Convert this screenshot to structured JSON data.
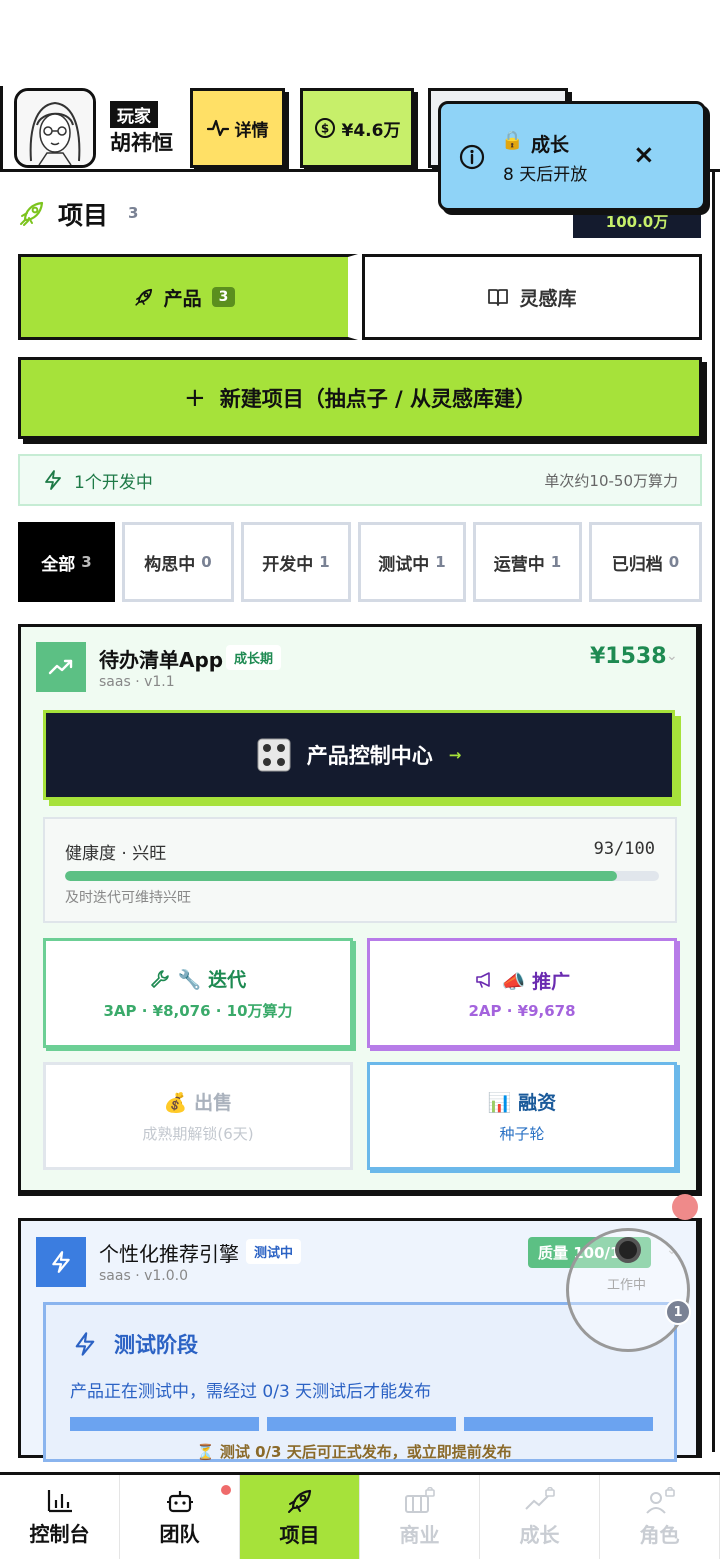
{
  "header": {
    "player_tag": "玩家",
    "player_name": "胡祎恒",
    "detail_label": "详情",
    "money_label": "¥4.6万"
  },
  "toast": {
    "title": "成长",
    "subtitle": "8 天后开放",
    "close": "×"
  },
  "dark_badge": "100.0万",
  "section": {
    "title": "项目",
    "count": "3"
  },
  "tabs": [
    {
      "label": "产品",
      "badge": "3"
    },
    {
      "label": "灵感库"
    }
  ],
  "new_project_label": "新建项目（抽点子 / 从灵感库建）",
  "dev_info": {
    "left": "1个开发中",
    "right": "单次约10-50万算力"
  },
  "filters": [
    {
      "label": "全部",
      "count": "3"
    },
    {
      "label": "构思中",
      "count": "0"
    },
    {
      "label": "开发中",
      "count": "1"
    },
    {
      "label": "测试中",
      "count": "1"
    },
    {
      "label": "运营中",
      "count": "1"
    },
    {
      "label": "已归档",
      "count": "0"
    }
  ],
  "project1": {
    "name": "待办清单App",
    "stage": "成长期",
    "meta": "saas · v1.1",
    "price": "¥1538",
    "control_center": "产品控制中心",
    "control_arrow": "→",
    "health_label": "健康度 · 兴旺",
    "health_value": "93/100",
    "health_ratio": 0.93,
    "health_hint": "及时迭代可维持兴旺",
    "actions": {
      "iterate": {
        "title": "🔧 迭代",
        "sub": "3AP · ¥8,076 · 10万算力"
      },
      "promote": {
        "title": "📣 推广",
        "sub": "2AP · ¥9,678"
      },
      "sell": {
        "title": "💰 出售",
        "sub": "成熟期解锁(6天)"
      },
      "finance": {
        "title": "📊 融资",
        "sub": "种子轮"
      }
    }
  },
  "project2": {
    "name": "个性化推荐引擎",
    "stage": "测试中",
    "meta": "saas · v1.0.0",
    "quality": "质量 100/100",
    "test_title": "测试阶段",
    "test_desc": "产品正在测试中，需经过 0/3 天测试后才能发布",
    "test_hint": "⏳ 测试 0/3 天后可正式发布，或立即提前发布"
  },
  "float_widget": {
    "label": "工作中",
    "count": "1"
  },
  "bottom_nav": [
    {
      "label": "控制台",
      "icon": "bar-chart-icon"
    },
    {
      "label": "团队",
      "icon": "robot-icon"
    },
    {
      "label": "项目",
      "icon": "rocket-icon"
    },
    {
      "label": "商业",
      "icon": "briefcase-icon"
    },
    {
      "label": "成长",
      "icon": "trend-icon"
    },
    {
      "label": "角色",
      "icon": "user-icon"
    }
  ],
  "colors": {
    "accent_green": "#a6e23a",
    "dark_navy": "#141b2e",
    "toast_blue": "#8fd3f7",
    "health_green": "#5cc084",
    "test_blue": "#2b62c4"
  }
}
